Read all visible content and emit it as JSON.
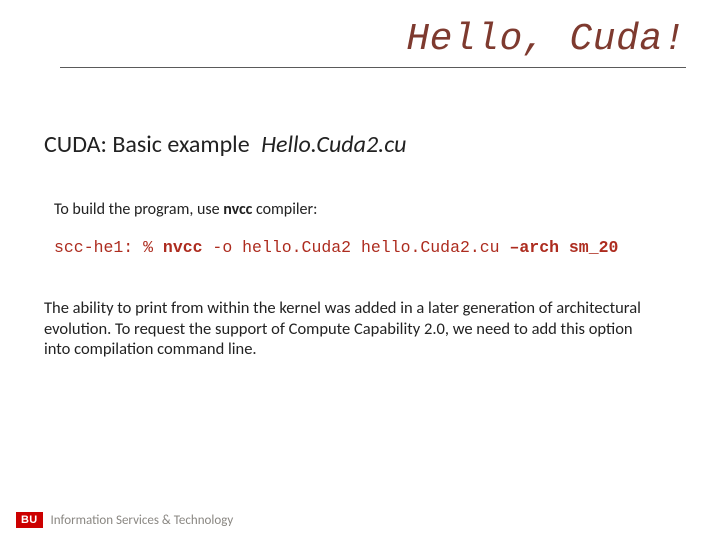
{
  "title": "Hello, Cuda!",
  "subtitle": {
    "prefix": "CUDA: Basic example ",
    "file": "Hello.Cuda2.cu"
  },
  "build_instruction": {
    "pre": "To build the program, use ",
    "bold": "nvcc",
    "post": " compiler:"
  },
  "code": {
    "prompt": "scc-he1: % ",
    "compiler": "nvcc",
    "middle": " -o hello.Cuda2 hello.Cuda2.cu ",
    "arch": "–arch sm_20"
  },
  "paragraph": "The ability to print from within the kernel was added in a later generation of architectural evolution. To request the support of Compute Capability 2.0, we need to add this option into compilation command line.",
  "footer": {
    "badge": "BU",
    "org": "Information Services & Technology"
  }
}
